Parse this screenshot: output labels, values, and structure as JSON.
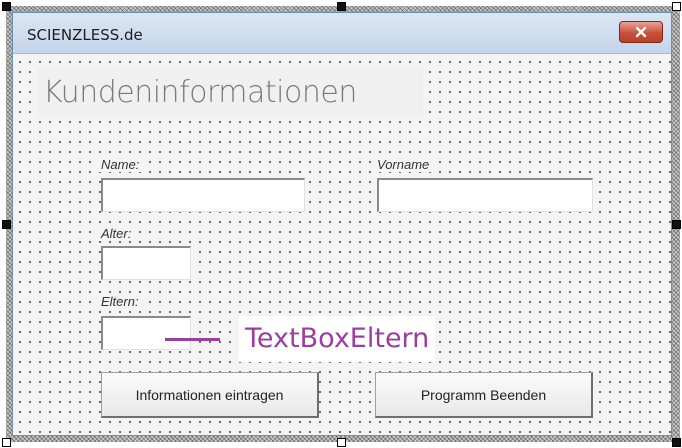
{
  "window": {
    "title": "SCIENZLESS.de",
    "close_icon": "close-icon"
  },
  "form": {
    "heading": "Kundeninformationen",
    "fields": {
      "name_label": "Name:",
      "vorname_label": "Vorname",
      "alter_label": "Alter:",
      "eltern_label": "Eltern:"
    },
    "buttons": {
      "informationen_eintragen": "Informationen eintragen",
      "programm_beenden": "Programm Beenden"
    }
  },
  "annotation": {
    "text": "TextBoxEltern",
    "color": "#9a3fa0"
  },
  "colors": {
    "close_button": "#c9513a",
    "titlebar": "#c4d5ea"
  }
}
